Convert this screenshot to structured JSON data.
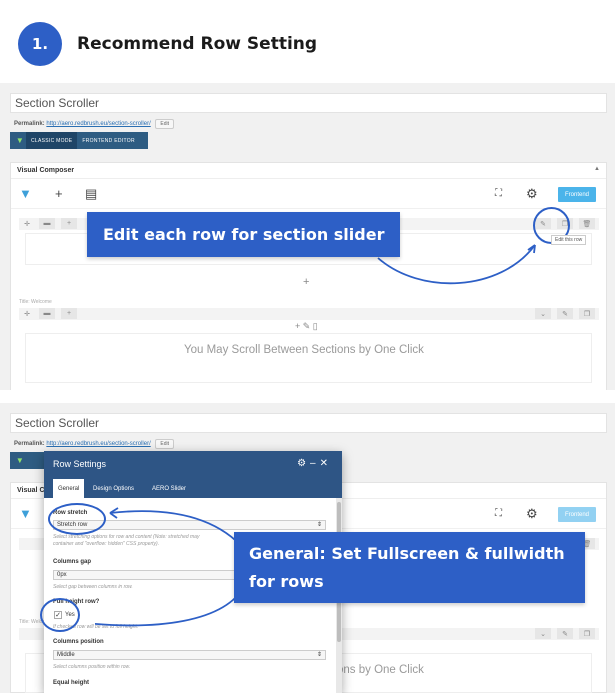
{
  "header": {
    "step_number": "1.",
    "title": "Recommend Row Setting"
  },
  "editor": {
    "post_title": "Section Scroller",
    "permalink_label": "Permalink:",
    "permalink_url": "http://aero.redbrush.eu/section-scroller/",
    "permalink_edit": "Edit",
    "classic_mode": "CLASSIC MODE",
    "frontend_editor": "FRONTEND EDITOR",
    "vc_title": "Visual Composer",
    "frontend_button": "Frontend",
    "row_title_label": "Title: Welcome",
    "scroll_text": "You May Scroll Between Sections by One Click",
    "edit_tooltip": "Edit this row"
  },
  "callouts": {
    "edit_rows": "Edit each row for section slider",
    "general_line1": "General: Set Fullscreen & fullwidth",
    "general_line2": "for rows"
  },
  "row_settings": {
    "title": "Row Settings",
    "tabs": [
      "General",
      "Design Options",
      "AERO Slider"
    ],
    "row_stretch_label": "Row stretch",
    "row_stretch_value": "Stretch row",
    "row_stretch_help": "Select stretching options for row and content (Note: stretched may",
    "row_stretch_help2": "container and \"overflow: hidden\" CSS property).",
    "columns_gap_label": "Columns gap",
    "columns_gap_value": "0px",
    "columns_gap_help": "Select gap between columns in row.",
    "full_height_label": "Full height row?",
    "full_height_option": "Yes",
    "full_height_help": "If checked row will be set to full height.",
    "columns_position_label": "Columns position",
    "columns_position_value": "Middle",
    "columns_position_help": "Select columns position within row.",
    "equal_height_label": "Equal height"
  },
  "colors": {
    "accent": "#2d5fc6",
    "modal_header": "#2e5585",
    "frontend_button": "#4bb4ea"
  }
}
